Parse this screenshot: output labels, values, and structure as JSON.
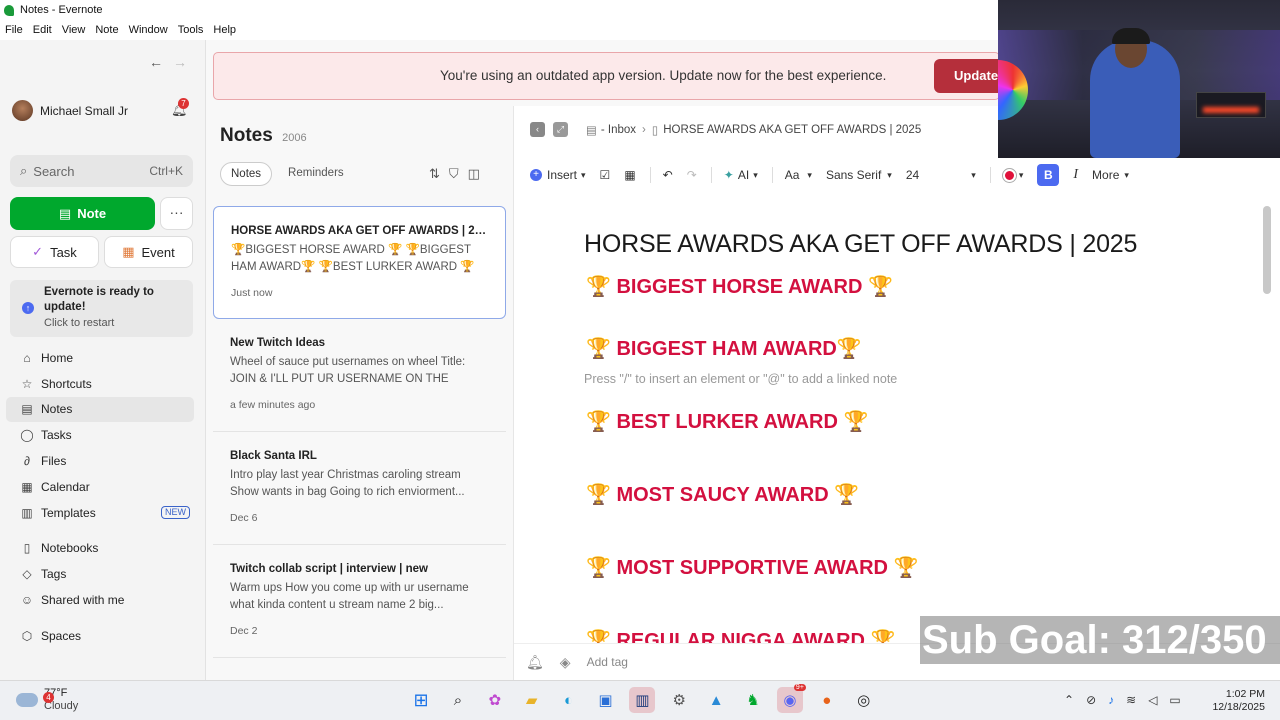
{
  "window": {
    "title": "Notes - Evernote"
  },
  "menu": [
    "File",
    "Edit",
    "View",
    "Note",
    "Window",
    "Tools",
    "Help"
  ],
  "sidebar": {
    "user_name": "Michael Small Jr",
    "bell_count": "7",
    "search_placeholder": "Search",
    "search_shortcut": "Ctrl+K",
    "note_button": "Note",
    "task_button": "Task",
    "event_button": "Event",
    "update_title": "Evernote is ready to update!",
    "update_sub": "Click to restart",
    "nav": [
      {
        "label": "Home",
        "icon": "home-icon",
        "glyph": "⌂"
      },
      {
        "label": "Shortcuts",
        "icon": "star-icon",
        "glyph": "☆"
      },
      {
        "label": "Notes",
        "icon": "notes-icon",
        "glyph": "▤"
      },
      {
        "label": "Tasks",
        "icon": "check-circle-icon",
        "glyph": "◯"
      },
      {
        "label": "Files",
        "icon": "paperclip-icon",
        "glyph": "∂"
      },
      {
        "label": "Calendar",
        "icon": "calendar-icon",
        "glyph": "▦"
      },
      {
        "label": "Templates",
        "icon": "template-icon",
        "glyph": "▥",
        "badge": "NEW"
      },
      {
        "label": "Notebooks",
        "icon": "notebook-icon",
        "glyph": "▯"
      },
      {
        "label": "Tags",
        "icon": "tag-icon",
        "glyph": "◇"
      },
      {
        "label": "Shared with me",
        "icon": "people-icon",
        "glyph": "☺"
      },
      {
        "label": "Spaces",
        "icon": "cube-icon",
        "glyph": "⬡"
      }
    ]
  },
  "banner": {
    "text": "You're using an outdated app version. Update now for the best experience.",
    "button": "Update"
  },
  "notes_list": {
    "title": "Notes",
    "count": "2006",
    "tabs": [
      "Notes",
      "Reminders"
    ],
    "items": [
      {
        "title": "HORSE AWARDS AKA GET OFF AWARDS | 2025",
        "preview": "🏆BIGGEST HORSE AWARD 🏆 🏆BIGGEST HAM AWARD🏆 🏆BEST LURKER AWARD 🏆 🏆MOS...",
        "date": "Just now"
      },
      {
        "title": "New Twitch Ideas",
        "preview": "Wheel of sauce put usernames on wheel Title: JOIN & I'LL PUT UR USERNAME ON THE WHEEL...",
        "date": "a few minutes ago"
      },
      {
        "title": "Black Santa IRL",
        "preview": "Intro play last year Christmas caroling stream Show wants in bag Going to rich enviorment...",
        "date": "Dec 6"
      },
      {
        "title": "Twitch collab script | interview | new",
        "preview": "Warm ups How you come up with ur username what kinda content u stream name 2 big...",
        "date": "Dec 2"
      }
    ]
  },
  "editor": {
    "breadcrumb_notebook": "- Inbox",
    "breadcrumb_note": "HORSE AWARDS AKA GET OFF AWARDS | 2025",
    "toolbar": {
      "insert": "Insert",
      "ai": "AI",
      "font_size_label": "Aa",
      "font": "Sans Serif",
      "size": "24",
      "bold": "B",
      "italic": "I",
      "more": "More"
    },
    "title": "HORSE AWARDS AKA GET OFF AWARDS | 2025",
    "awards": [
      "🏆 BIGGEST HORSE AWARD 🏆",
      "🏆 BIGGEST HAM AWARD🏆",
      "🏆 BEST LURKER AWARD 🏆",
      "🏆 MOST SAUCY AWARD 🏆",
      "🏆 MOST SUPPORTIVE AWARD 🏆",
      "🏆 REGULAR NIGGA AWARD 🏆"
    ],
    "hint": "Press \"/\" to insert an element or \"@\" to add a linked note",
    "add_tag": "Add tag",
    "text_color": "#e0113b"
  },
  "overlay": {
    "sub_goal": "Sub Goal: 312/350"
  },
  "taskbar": {
    "weather_temp": "77°F",
    "weather_cond": "Cloudy",
    "weather_badge": "4",
    "time": "1:02 PM",
    "date": "12/18/2025",
    "discord_badge": "9+"
  }
}
